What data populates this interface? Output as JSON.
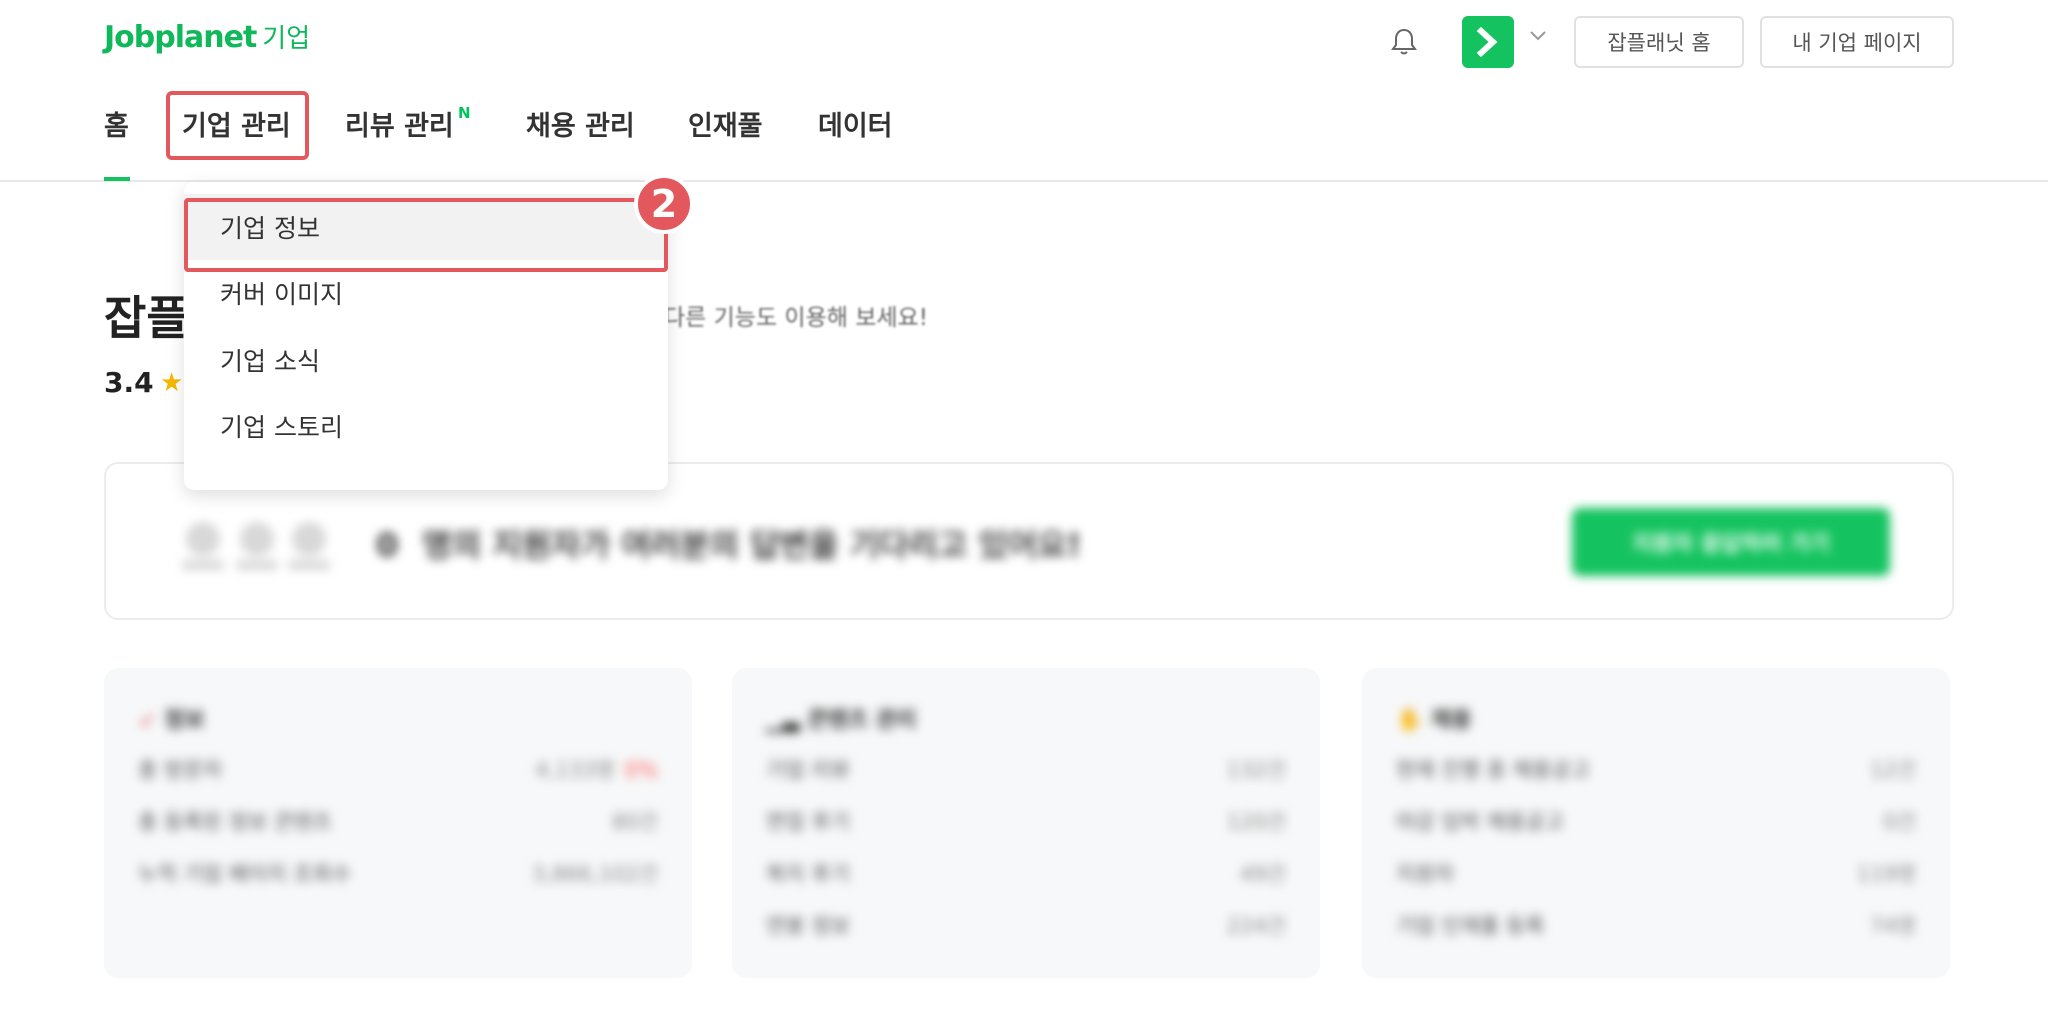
{
  "header": {
    "logo_brand": "Jobplanet",
    "logo_sub": "기업",
    "buttons": {
      "jobplanet_home": "잡플래닛 홈",
      "my_company_page": "내 기업 페이지"
    }
  },
  "nav": {
    "items": [
      {
        "label": "홈"
      },
      {
        "label": "기업 관리"
      },
      {
        "label": "리뷰 관리",
        "badge": "N"
      },
      {
        "label": "채용 관리"
      },
      {
        "label": "인재풀"
      },
      {
        "label": "데이터"
      }
    ],
    "active": "홈",
    "highlighted": "기업 관리"
  },
  "dropdown": {
    "items": [
      {
        "label": "기업 정보"
      },
      {
        "label": "커버 이미지"
      },
      {
        "label": "기업 소식"
      },
      {
        "label": "기업 스토리"
      }
    ],
    "highlighted": "기업 정보"
  },
  "annotation": {
    "step": "2",
    "color": "#e3585d"
  },
  "background": {
    "title": "잡플",
    "subtitle": "다른 기능도 이용해 보세요!",
    "rating": "3.4",
    "banner": {
      "text": "명의 지원자가 여러분의 답변을 기다리고 있어요!",
      "count": "0",
      "button": "지원자 응답하러 가기"
    },
    "cards": [
      {
        "title": "정보",
        "rows": [
          {
            "label": "총 방문자",
            "value": "4,133명",
            "delta": "0%"
          },
          {
            "label": "총 등록된 정보 콘텐츠",
            "value": "80건"
          },
          {
            "label": "누적 기업 페이지 조회수",
            "value": "3,866,102건"
          }
        ]
      },
      {
        "title": "콘텐츠 관리",
        "rows": [
          {
            "label": "기업 리뷰",
            "value": "132건"
          },
          {
            "label": "면접 후기",
            "value": "120건"
          },
          {
            "label": "복지 후기",
            "value": "49건"
          },
          {
            "label": "연봉 정보",
            "value": "224건"
          }
        ]
      },
      {
        "title": "채용",
        "rows": [
          {
            "label": "현재 진행 중 채용공고",
            "value": "12건"
          },
          {
            "label": "마감 임박 채용공고",
            "value": "0건"
          },
          {
            "label": "지원자",
            "value": "119명"
          },
          {
            "label": "기업 인재풀 등록",
            "value": "74명"
          }
        ]
      }
    ]
  },
  "colors": {
    "brand": "#14c35f",
    "highlight": "#e3585d"
  }
}
